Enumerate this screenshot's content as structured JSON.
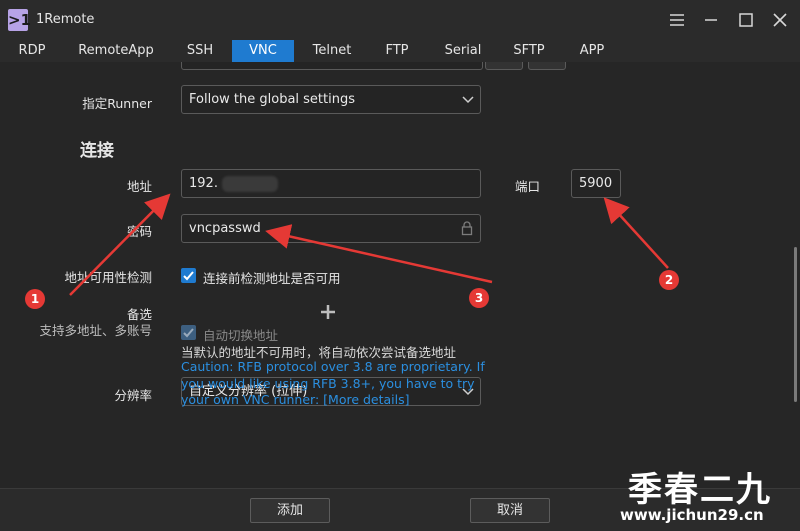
{
  "app": {
    "logo_text": ">1",
    "title": "1Remote"
  },
  "tabs": [
    {
      "label": "RDP",
      "active": false
    },
    {
      "label": "RemoteApp",
      "active": false
    },
    {
      "label": "SSH",
      "active": false
    },
    {
      "label": "VNC",
      "active": true
    },
    {
      "label": "Telnet",
      "active": false
    },
    {
      "label": "FTP",
      "active": false
    },
    {
      "label": "Serial",
      "active": false
    },
    {
      "label": "SFTP",
      "active": false
    },
    {
      "label": "APP",
      "active": false
    }
  ],
  "form": {
    "runner_label": "指定Runner",
    "runner_value": "Follow the global settings",
    "connection_heading": "连接",
    "address_label": "地址",
    "address_value": "192.",
    "port_label": "端口",
    "port_value": "5900",
    "password_label": "密码",
    "password_value": "vncpasswd",
    "check_label": "地址可用性检测",
    "check_text": "连接前检测地址是否可用",
    "check_checked": true,
    "backup_label": "备选",
    "backup_sublabel": "支持多地址、多账号",
    "auto_switch_text": "自动切换地址",
    "auto_switch_hint": "当默认的地址不可用时，将自动依次尝试备选地址",
    "resolution_label": "分辨率",
    "resolution_value": "自定义分辨率 (拉伸)",
    "caution": "Caution: RFB protocol over 3.8 are proprietary. If you would like using RFB 3.8+, you have to try your own VNC runner: [More details]"
  },
  "footer": {
    "add_label": "添加",
    "cancel_label": "取消"
  },
  "annotations": {
    "badge1": "1",
    "badge2": "2",
    "badge3": "3",
    "arrow_color": "#e53935"
  },
  "watermark": {
    "title": "季春二九",
    "url": "www.jichun29.cn"
  },
  "colors": {
    "accent": "#1f7bd0",
    "link": "#2b8fe0",
    "badge": "#e53935"
  }
}
